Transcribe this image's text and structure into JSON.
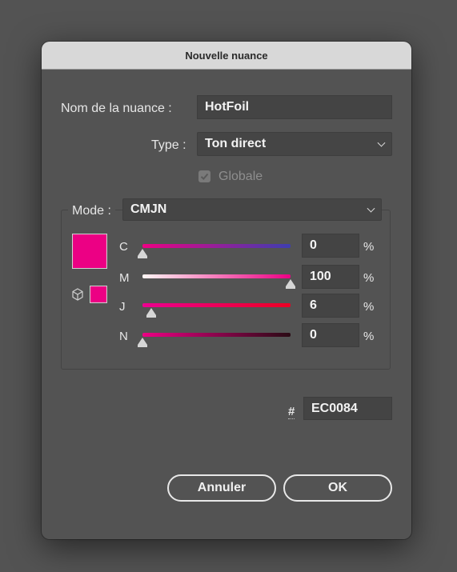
{
  "dialog": {
    "title": "Nouvelle nuance",
    "name_label": "Nom de la nuance :",
    "name_value": "HotFoil",
    "type_label": "Type :",
    "type_value": "Ton direct",
    "global_label": "Globale",
    "global_checked": true,
    "global_enabled": false,
    "mode_label": "Mode :",
    "mode_value": "CMJN",
    "swatch_color": "#EC0084",
    "channels": [
      {
        "label": "C",
        "value": "0",
        "unit": "%"
      },
      {
        "label": "M",
        "value": "100",
        "unit": "%"
      },
      {
        "label": "J",
        "value": "6",
        "unit": "%"
      },
      {
        "label": "N",
        "value": "0",
        "unit": "%"
      }
    ],
    "hex_label": "#",
    "hex_value": "EC0084",
    "cancel_label": "Annuler",
    "ok_label": "OK"
  }
}
